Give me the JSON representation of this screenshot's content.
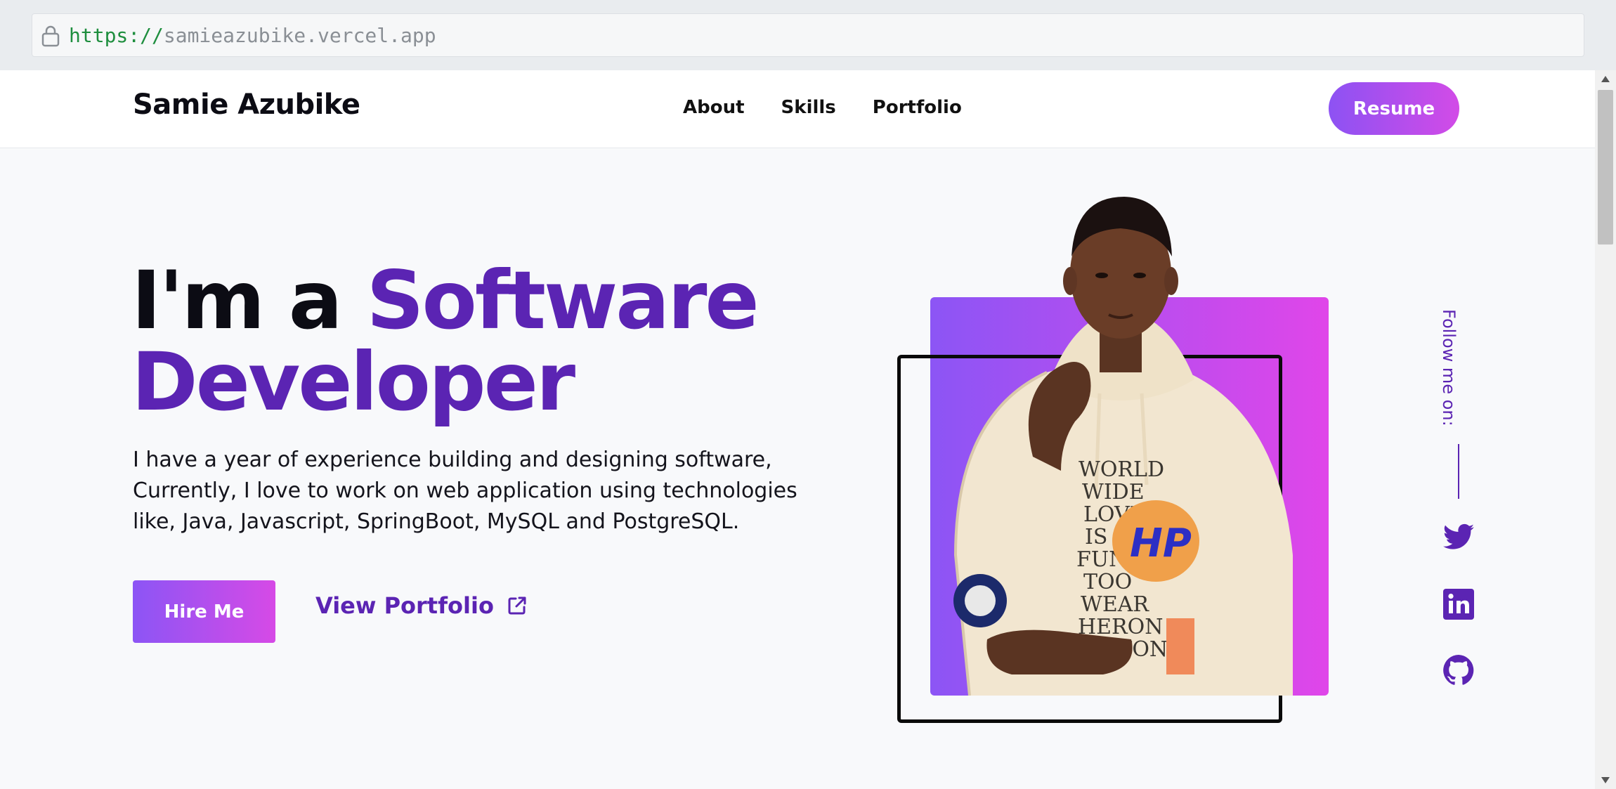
{
  "browser": {
    "url_scheme": "https://",
    "url_host": "samieazubike.vercel.app"
  },
  "nav": {
    "brand": "Samie Azubike",
    "links": [
      "About",
      "Skills",
      "Portfolio"
    ],
    "resume_label": "Resume"
  },
  "hero": {
    "title_part1": "I'm a",
    "title_part2": "Software",
    "title_part3": "Developer",
    "description": "I have a year of experience building and designing software, Currently, I love to work on web application using technologies like, Java, Javascript, SpringBoot, MySQL and PostgreSQL.",
    "hire_label": "Hire Me",
    "portfolio_label": "View Portfolio"
  },
  "social": {
    "follow_label": "Follow me on:",
    "icons": [
      "twitter-icon",
      "linkedin-icon",
      "github-icon"
    ]
  },
  "colors": {
    "accent": "#5b24b3",
    "gradient_start": "#8c55f5",
    "gradient_end": "#d64ae6"
  },
  "hoodie_text": {
    "lines": [
      "WORLD",
      "WIDE",
      "LOVE",
      "IS",
      "FUN",
      "TOO",
      "WEAR",
      "HERON",
      "PRSTON"
    ],
    "logo": "HP"
  }
}
